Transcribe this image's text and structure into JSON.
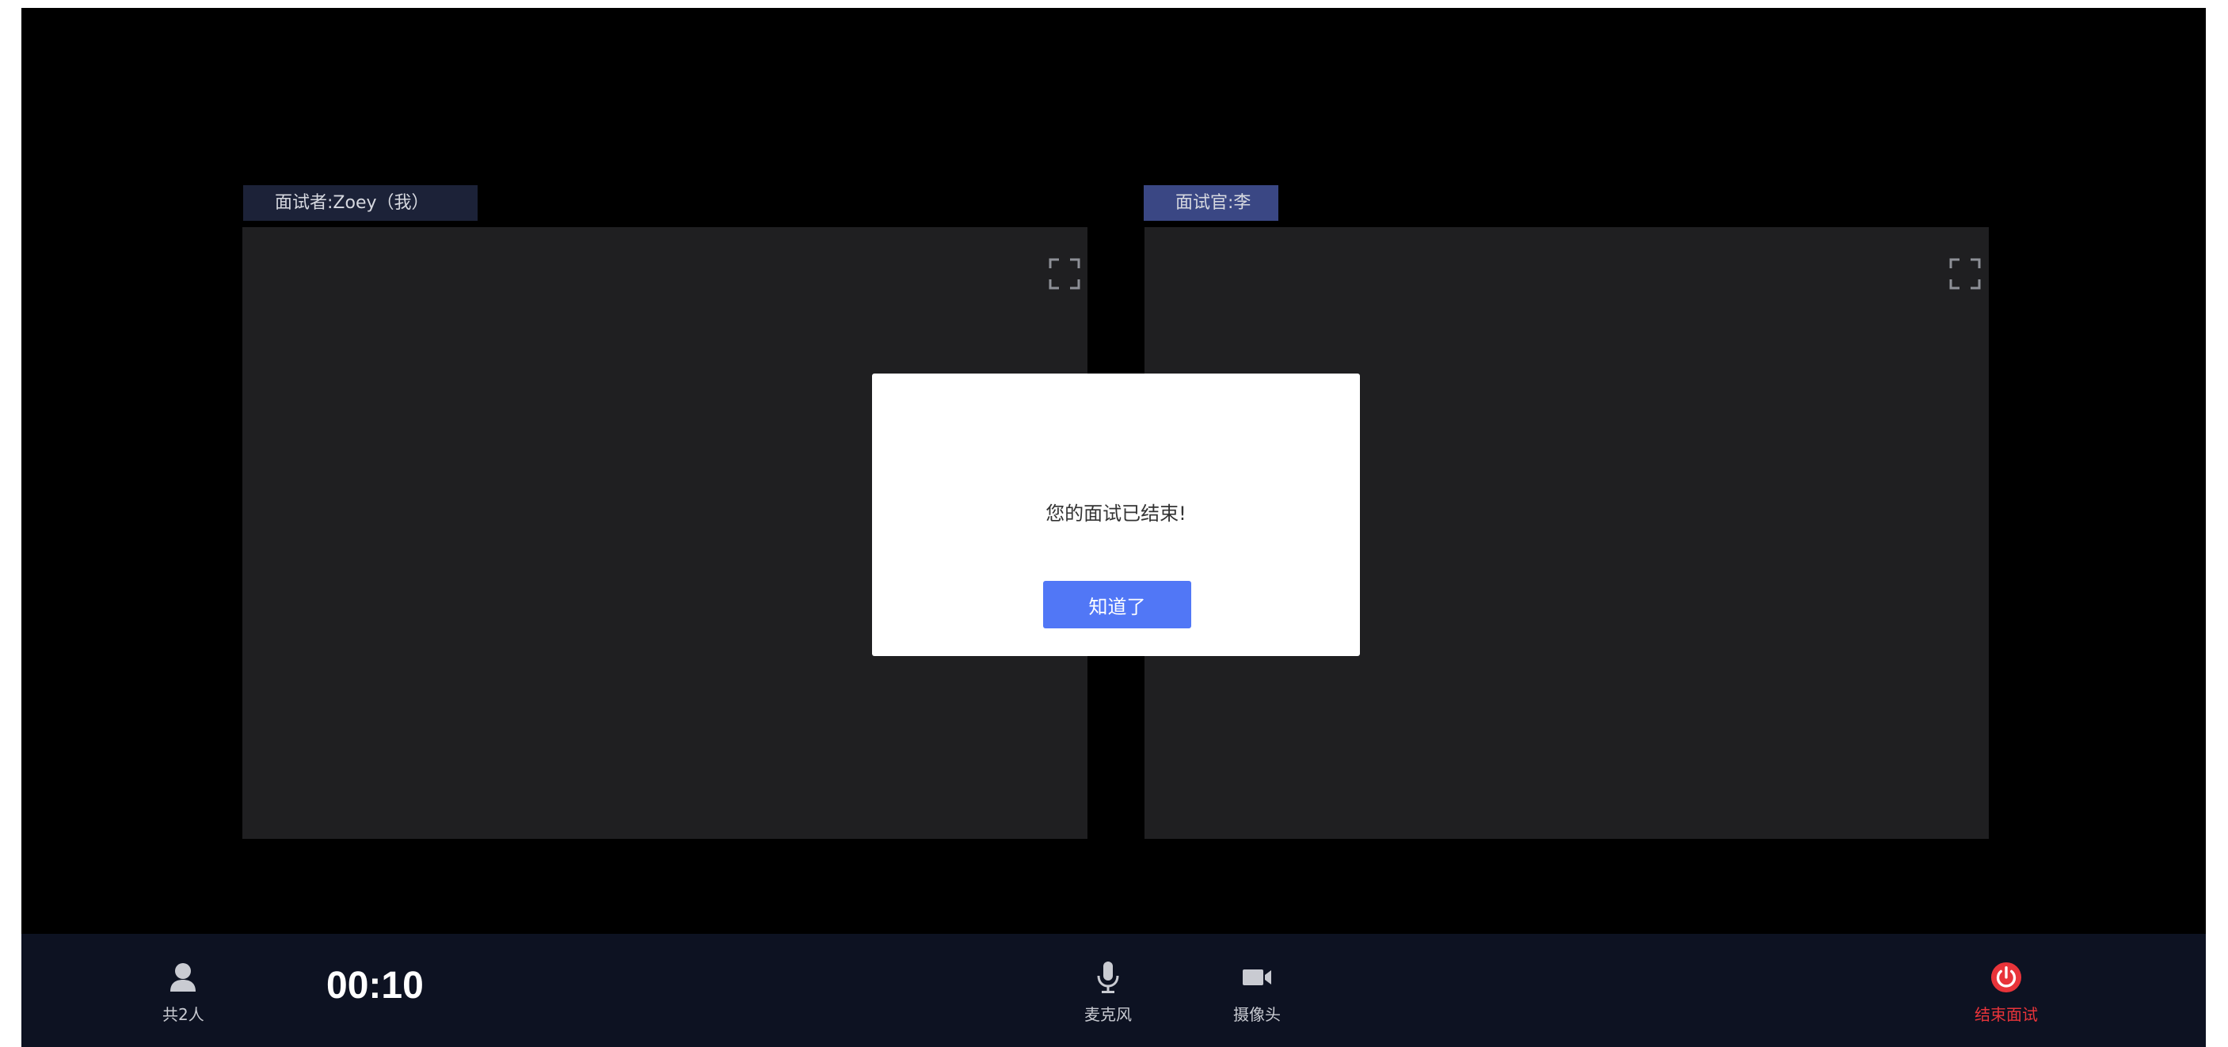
{
  "participants": {
    "left": {
      "tag": "面试者:Zoey（我）"
    },
    "right": {
      "tag": "面试官:李"
    }
  },
  "modal": {
    "message": "您的面试已结束!",
    "ok_label": "知道了"
  },
  "bottom_bar": {
    "people_label": "共2人",
    "timer": "00:10",
    "mic_label": "麦克风",
    "camera_label": "摄像头",
    "end_label": "结束面试"
  },
  "colors": {
    "stage_bg": "#000000",
    "pane_bg": "#1f1f21",
    "left_tag_bg": "#1c2238",
    "right_tag_bg": "#3a4784",
    "button_blue": "#5177f6",
    "bottom_bar_bg": "#0d1222",
    "end_red": "#e8343a"
  },
  "icons": {
    "people": "user-icon",
    "mic": "microphone-icon",
    "camera": "video-camera-icon",
    "end": "power-icon",
    "fullscreen": "fullscreen-icon"
  }
}
